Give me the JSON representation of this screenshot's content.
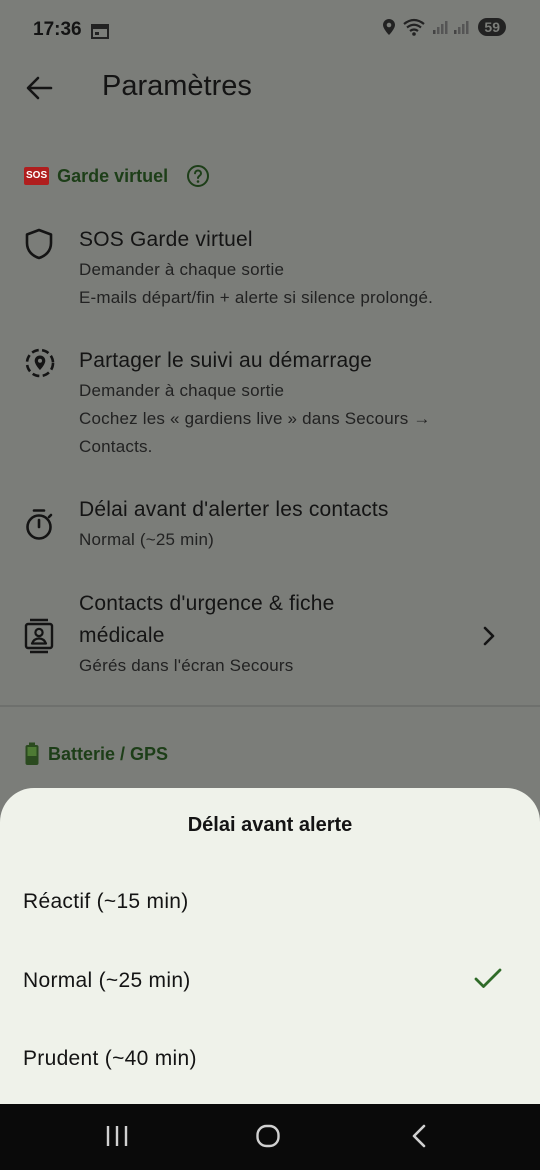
{
  "status": {
    "time": "17:36",
    "battery": "59"
  },
  "appbar": {
    "title": "Paramètres"
  },
  "sections": {
    "garde": {
      "badge": "SOS",
      "label": "Garde virtuel"
    },
    "battery": {
      "label": "Batterie / GPS"
    }
  },
  "items": [
    {
      "title": "SOS Garde virtuel",
      "subtitle_1": "Demander à chaque sortie",
      "subtitle_2": "E-mails départ/fin + alerte si silence prolongé."
    },
    {
      "title": "Partager le suivi au démarrage",
      "subtitle_1": "Demander à chaque sortie",
      "subtitle_2": "Cochez les « gardiens live » dans Secours →",
      "subtitle_3": "Contacts."
    },
    {
      "title": "Délai avant d'alerter les contacts",
      "subtitle_1": "Normal (~25 min)"
    },
    {
      "title_1": "Contacts d'urgence & fiche",
      "title_2": "médicale",
      "subtitle_1": "Gérés dans l'écran Secours"
    }
  ],
  "sheet": {
    "title": "Délai avant alerte",
    "options": [
      {
        "label": "Réactif (~15 min)",
        "selected": false
      },
      {
        "label": "Normal (~25 min)",
        "selected": true
      },
      {
        "label": "Prudent (~40 min)",
        "selected": false
      }
    ]
  },
  "colors": {
    "scrim": "#7b7d79",
    "sheet": "#eff2ea",
    "accent": "#2f6b28",
    "section": "#1d3e18"
  },
  "icons": [
    "calendar-icon",
    "location-icon",
    "wifi-icon",
    "signal-icon",
    "back-arrow-icon",
    "help-icon",
    "shield-icon",
    "share-location-icon",
    "timer-icon",
    "contact-card-icon",
    "chevron-right-icon",
    "battery-icon",
    "check-icon",
    "recents-icon",
    "home-icon",
    "nav-back-icon"
  ]
}
